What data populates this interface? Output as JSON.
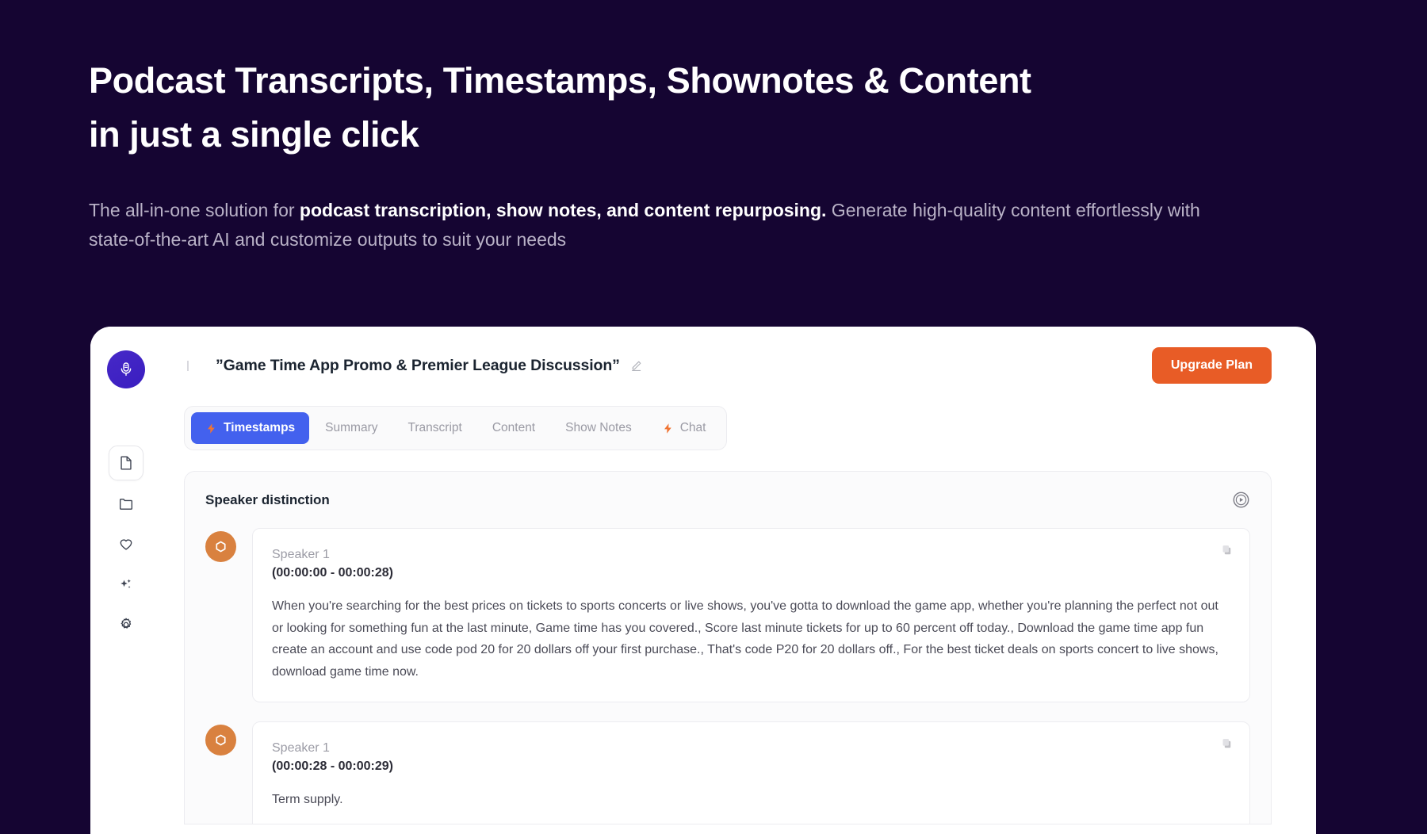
{
  "hero": {
    "title_line1": "Podcast Transcripts, Timestamps, Shownotes & Content",
    "title_line2": "in just a single click",
    "sub_part1": "The all-in-one solution for ",
    "sub_bold": "podcast transcription, show notes, and content repurposing.",
    "sub_part2": " Generate high-quality content effortlessly with state-of-the-art AI and customize outputs to suit your needs"
  },
  "colors": {
    "page_background": "#150532",
    "accent_orange": "#e85c26",
    "accent_blue": "#4361ee",
    "brand_purple": "#4628c7",
    "avatar_orange": "#d9813f"
  },
  "sidebar": {
    "logo_icon": "microphone-icon",
    "items": [
      {
        "icon": "document-icon",
        "label": "Documents",
        "active": true
      },
      {
        "icon": "folder-icon",
        "label": "Folders",
        "active": false
      },
      {
        "icon": "heart-icon",
        "label": "Favorites",
        "active": false
      },
      {
        "icon": "sparkles-icon",
        "label": "AI Magic",
        "active": false
      },
      {
        "icon": "gear-icon",
        "label": "Settings",
        "active": false
      }
    ]
  },
  "topbar": {
    "document_title": "”Game Time App Promo & Premier League Discussion”",
    "edit_icon": "pencil-icon",
    "upgrade_label": "Upgrade Plan"
  },
  "tabs": [
    {
      "label": "Timestamps",
      "icon": "lightning-icon",
      "active": true
    },
    {
      "label": "Summary",
      "icon": "",
      "active": false
    },
    {
      "label": "Transcript",
      "icon": "",
      "active": false
    },
    {
      "label": "Content",
      "icon": "",
      "active": false
    },
    {
      "label": "Show Notes",
      "icon": "",
      "active": false
    },
    {
      "label": "Chat",
      "icon": "lightning-icon",
      "active": false
    }
  ],
  "panel": {
    "title": "Speaker distinction",
    "play_icon": "play-circle-icon",
    "segments": [
      {
        "speaker": "Speaker 1",
        "time": "(00:00:00 - 00:00:28)",
        "text": "When you're searching for the best prices on tickets to sports concerts or live shows, you've gotta to download the game app, whether you're planning the perfect not out or looking for something fun at the last minute, Game time has you covered., Score last minute tickets for up to 60 percent off today., Download the game time app fun create an account and use code pod 20 for 20 dollars off your first purchase., That's code P20 for 20 dollars off., For the best ticket deals on sports concert to live shows, download game time now.",
        "copy_icon": "copy-icon"
      },
      {
        "speaker": "Speaker 1",
        "time": "(00:00:28 - 00:00:29)",
        "text": "Term supply.",
        "copy_icon": "copy-icon"
      }
    ]
  }
}
